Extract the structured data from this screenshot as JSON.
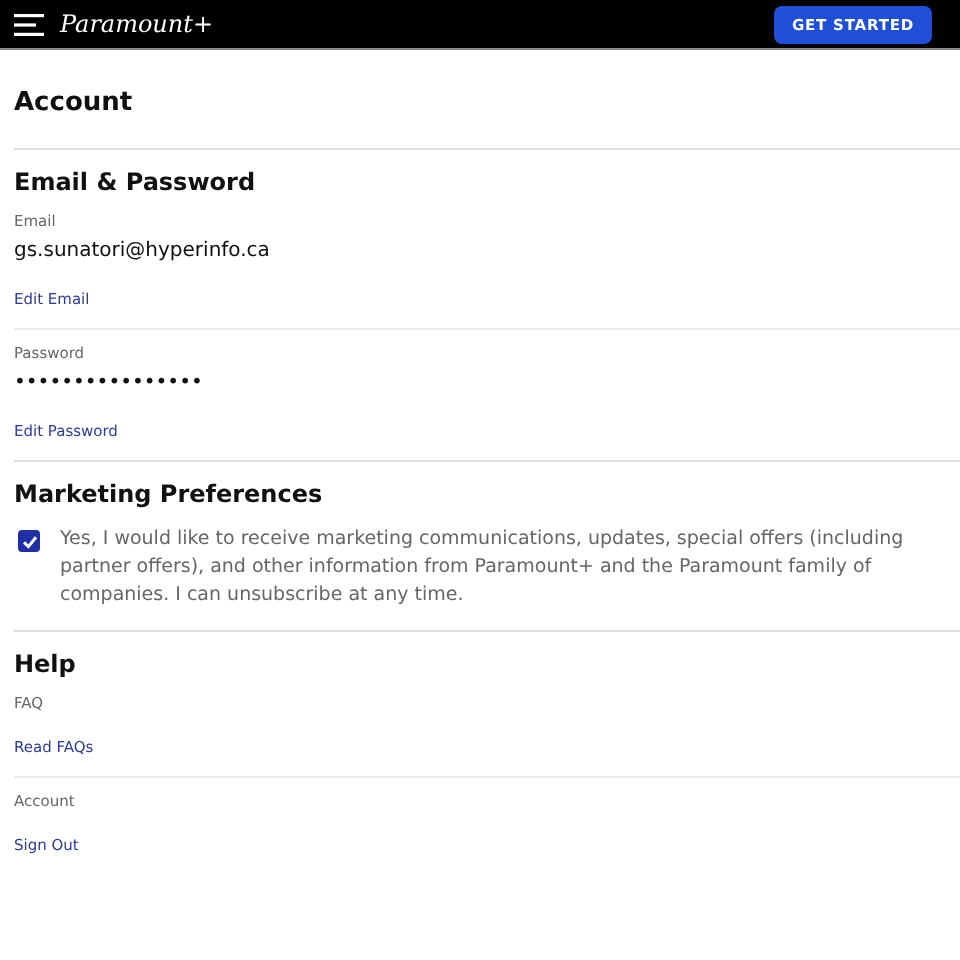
{
  "header": {
    "logo": "Paramount+",
    "cta": "GET STARTED"
  },
  "page_title": "Account",
  "sections": [
    {
      "title": "Email & Password",
      "items": [
        {
          "kind": "field",
          "label": "Email",
          "value": "gs.sunatori@hyperinfo.ca",
          "link": "Edit Email"
        },
        {
          "kind": "field",
          "label": "Password",
          "value": "••••••••••••••••",
          "link": "Edit Password"
        }
      ]
    },
    {
      "title": "Marketing Preferences",
      "items": [
        {
          "kind": "checkbox",
          "checked": true,
          "text": "Yes, I would like to receive marketing communications, updates, special offers (including partner offers), and other information from Paramount+ and the Paramount family of companies. I can unsubscribe at any time."
        }
      ]
    },
    {
      "title": "Help",
      "items": [
        {
          "kind": "link",
          "label": "FAQ",
          "link": "Read FAQs"
        },
        {
          "kind": "link",
          "label": "Account",
          "link": "Sign Out"
        }
      ]
    }
  ]
}
